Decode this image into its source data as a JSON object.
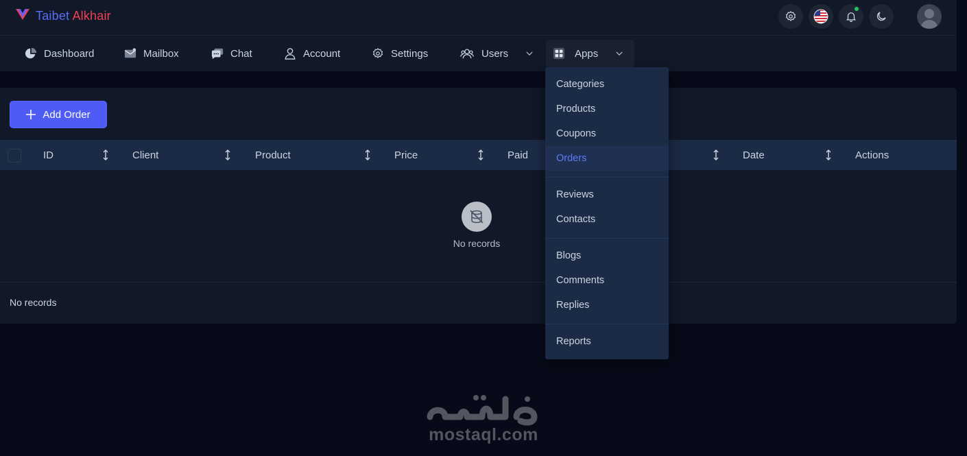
{
  "brand": {
    "name_part1": "Taibet",
    "name_part2": "Alkhair"
  },
  "top_actions": [
    "settings-icon",
    "us-flag-icon",
    "bell-icon",
    "moon-icon"
  ],
  "nav": {
    "dashboard": "Dashboard",
    "mailbox": "Mailbox",
    "chat": "Chat",
    "account": "Account",
    "settings": "Settings",
    "users": "Users",
    "apps": "Apps"
  },
  "apps_menu": {
    "group1": [
      "Categories",
      "Products",
      "Coupons",
      "Orders"
    ],
    "group2": [
      "Reviews",
      "Contacts"
    ],
    "group3": [
      "Blogs",
      "Comments",
      "Replies"
    ],
    "group4": [
      "Reports"
    ],
    "active": "Orders"
  },
  "toolbar": {
    "add_order": "Add Order"
  },
  "table": {
    "columns": {
      "id": "ID",
      "client": "Client",
      "product": "Product",
      "price": "Price",
      "paid": "Paid",
      "date": "Date",
      "actions": "Actions"
    },
    "empty_message": "No records"
  },
  "footer": {
    "text": "No records"
  },
  "watermark": {
    "text": "mostaql.com"
  },
  "colors": {
    "primary": "#4f5bf5",
    "accent_blue": "#5b7cf9",
    "brand_red": "#ef4056",
    "status_green": "#22c55e"
  }
}
